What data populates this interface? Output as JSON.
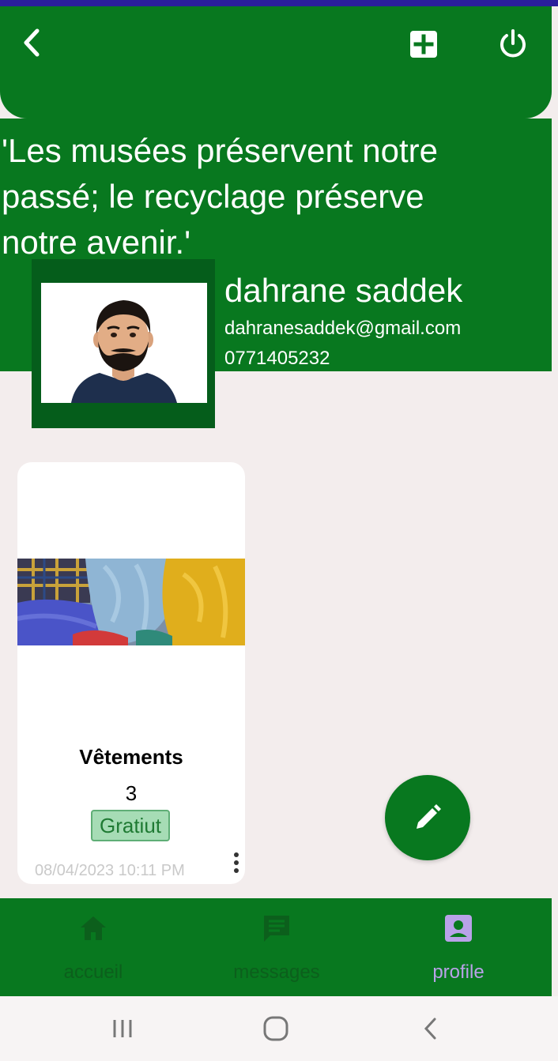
{
  "quote": "'Les musées préservent notre passé; le recyclage préserve notre avenir.'",
  "profile": {
    "name": "dahrane saddek",
    "email": "dahranesaddek@gmail.com",
    "phone": "0771405232"
  },
  "post": {
    "title": "Vêtements",
    "quantity": "3",
    "price_badge": "Gratiut",
    "date": "08/04/2023 10:11 PM"
  },
  "nav": {
    "items": [
      {
        "label": "accueil",
        "icon": "home-icon",
        "active": false
      },
      {
        "label": "messages",
        "icon": "message-icon",
        "active": false
      },
      {
        "label": "profile",
        "icon": "profile-icon",
        "active": true
      }
    ]
  },
  "colors": {
    "primary_green": "#08781f",
    "status_strip": "#2a1e9c",
    "background": "#f3eded",
    "active_nav": "#b9a2e8",
    "inactive_nav": "#0c5f1c"
  },
  "icons": [
    "back-arrow-icon",
    "add-box-icon",
    "power-icon",
    "edit-pencil-icon",
    "menu-icon",
    "circle-home-icon",
    "back-chevron-icon"
  ]
}
